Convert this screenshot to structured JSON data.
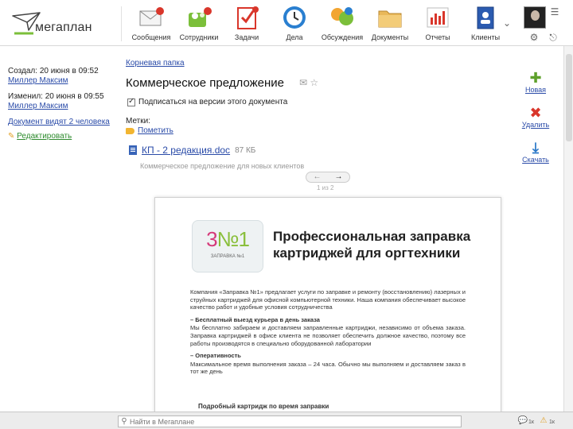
{
  "app": {
    "logo_text": "мегаплан",
    "nav": [
      {
        "label": "Сообщения",
        "icon": "envelope-icon",
        "badge": ""
      },
      {
        "label": "Сотрудники",
        "icon": "people-icon",
        "badge": ""
      },
      {
        "label": "Задачи",
        "icon": "tasks-icon",
        "badge": ""
      },
      {
        "label": "Дела",
        "icon": "clock-icon",
        "badge": ""
      },
      {
        "label": "Обсуждения",
        "icon": "chat-icon",
        "badge": ""
      },
      {
        "label": "Документы",
        "icon": "folder-icon",
        "badge": ""
      },
      {
        "label": "Отчеты",
        "icon": "chart-icon",
        "badge": ""
      },
      {
        "label": "Клиенты",
        "icon": "contacts-book-icon",
        "badge": ""
      }
    ]
  },
  "left": {
    "created_label": "Создал: 20 июня в 09:52",
    "created_by": "Миллер Максим",
    "changed_label": "Изменил: 20 июня в 09:55",
    "changed_by": "Миллер Максим",
    "visible_to": "Документ видят 2 человека",
    "edit_link": "Редактировать"
  },
  "main": {
    "breadcrumb": "Корневая папка",
    "title": "Коммерческое предложение",
    "subscribe_label": "Подписаться на версии этого документа",
    "labels_title": "Метки:",
    "add_label": "Пометить",
    "file_name": "КП - 2 редакция.doc",
    "file_size": "87 КБ",
    "file_desc": "Коммерческое предложение для новых клиентов",
    "pager_prev": "←",
    "pager_next": "→",
    "pager_count": "1 из 2"
  },
  "actions": {
    "new_version": "Новая",
    "delete": "Удалить",
    "download": "Скачать"
  },
  "preview": {
    "logo_main_a": "3",
    "logo_main_b": "№1",
    "logo_sub": "ЗАПРАВКА №1",
    "heading": "Профессиональная заправка картриджей для оргтехники",
    "intro": "Компания «Заправка №1» предлагает услуги по заправке и ремонту (восстановлению) лазерных и струйных картриджей для офисной компьютерной техники. Наша компания обеспечивает высокое качество работ и удобные условия сотрудничества",
    "point1_title": "– Бесплатный выезд курьера в день заказа",
    "point1_text": "Мы бесплатно забираем и доставляем заправленные картриджи, независимо от объема заказа. Заправка картриджей в офисе клиента не позволяет обеспечить должное качество, поэтому все работы производятся в специально оборудованной лаборатории",
    "point2_title": "– Оперативность",
    "point2_text": "Максимальное время выполнения заказа – 24 часа. Обычно мы выполняем и доставляем заказ в тот же день",
    "table_title": "Подробный картридж по время заправки"
  },
  "bottom": {
    "search_placeholder": "Найти в Мегаплане",
    "count_1": "1к",
    "count_2": "1к"
  },
  "colors": {
    "link": "#2a4ba8",
    "new_green": "#5ea02b",
    "delete_red": "#d9362b",
    "download_blue": "#2a78c8"
  }
}
